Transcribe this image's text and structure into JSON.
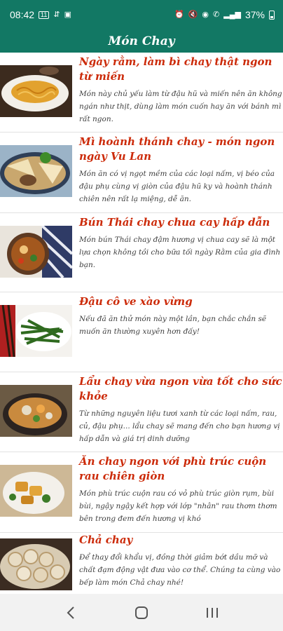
{
  "status": {
    "time": "08:42",
    "left_icons": [
      "sim-icon",
      "signal-arrow-icon",
      "gallery-icon"
    ],
    "right_icons": [
      "alarm-icon",
      "mute-icon",
      "hotspot-icon",
      "wifi-call-icon",
      "signal-icon"
    ],
    "battery": "37%"
  },
  "appbar": {
    "title": "Món Chay"
  },
  "colors": {
    "primary": "#127864",
    "title_red": "#cc2b0a",
    "text": "#3e3e3e"
  },
  "items": [
    {
      "title": "Ngày rằm, làm bì chay thật ngon từ miến",
      "desc": "Món này chủ yếu làm từ đậu hũ và miến nên ăn không ngán như thịt, dùng làm món cuốn hay ăn với bánh mì rất ngon.",
      "image": "fried-noodles-photo"
    },
    {
      "title": "Mì hoành thánh chay - món ngon ngày Vu Lan",
      "desc": "Món ăn có vị ngọt mềm của các loại nấm, vị béo của đậu phụ cùng vị giòn của đậu hũ ky và hoành thánh chiên nên rất lạ miệng, dễ ăn.",
      "image": "wonton-noodle-photo"
    },
    {
      "title": "Bún Thái chay chua cay hấp dẫn",
      "desc": "Món bún Thái chay đậm hương vị chua cay sẽ là một lựa chọn không tồi cho bữa tối ngày Rằm của gia đình bạn.",
      "image": "thai-noodle-soup-photo"
    },
    {
      "title": "Đậu cô ve xào vừng",
      "desc": "Nếu đã ăn thử món này một lần, bạn chắc chắn sẽ muốn ăn thường xuyên hơn đấy!",
      "image": "green-beans-photo"
    },
    {
      "title": "Lẩu chay vừa ngon vừa tốt cho sức khỏe",
      "desc": "Từ những nguyên liệu tươi xanh từ các loại nấm, rau, củ, đậu phụ... lẩu chay sẽ mang đến cho bạn hương vị hấp dẫn và giá trị dinh dưỡng",
      "image": "hotpot-photo"
    },
    {
      "title": "Ăn chay ngon với phù trúc cuộn rau chiên giòn",
      "desc": "Món phù trúc cuộn rau có vỏ phù trúc giòn rụm, bùi bùi, ngậy ngậy kết hợp với lớp \"nhân\" rau thơm thơm bên trong đem đến hương vị khó",
      "image": "tofu-skin-roll-photo"
    },
    {
      "title": "Chả chay",
      "desc": "Để thay đổi khẩu vị, đồng thời giảm bớt dầu mỡ và chất đạm động vật đưa vào cơ thể. Chúng ta cùng vào bếp làm món Chả chay nhé!",
      "image": "vegetarian-sausage-photo"
    }
  ],
  "navbar": {
    "back_icon": "back-icon",
    "home_icon": "home-icon",
    "recents_icon": "recents-icon"
  }
}
